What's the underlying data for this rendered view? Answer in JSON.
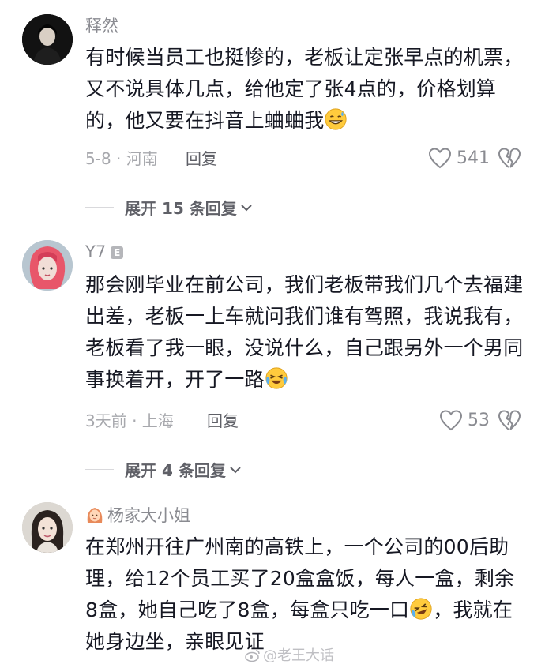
{
  "comments": [
    {
      "name": "释然",
      "text": "有时候当员工也挺惨的，老板让定张早点的机票，又不说具体几点，给他定了张4点的，价格划算的，他又要在抖音上蛐蛐我",
      "emoji": "grinning-sweat-emoji",
      "meta": "5-8 · 河南",
      "reply_label": "回复",
      "likes": "541",
      "expand": "展开 15 条回复"
    },
    {
      "name": "Y7",
      "badge": "E",
      "text": "那会刚毕业在前公司，我们老板带我们几个去福建出差，老板一上车就问我们谁有驾照，我说我有，老板看了我一眼，没说什么，自己跟另外一个男同事换着开，开了一路",
      "emoji": "crying-laughing-emoji",
      "meta": "3天前 · 上海",
      "reply_label": "回复",
      "likes": "53",
      "expand": "展开 4 条回复"
    },
    {
      "name": "杨家大小姐",
      "text_before": "在郑州开往广州南的高铁上，一个公司的00后助理，给12个员工买了20盒盒饭，每人一盒，剩余8盒，她自己吃了8盒，每盒只吃一口",
      "text_after": "，我就在她身边坐，亲眼见证",
      "emoji": "rolling-laughing-emoji"
    }
  ],
  "watermark": "@老王大话"
}
